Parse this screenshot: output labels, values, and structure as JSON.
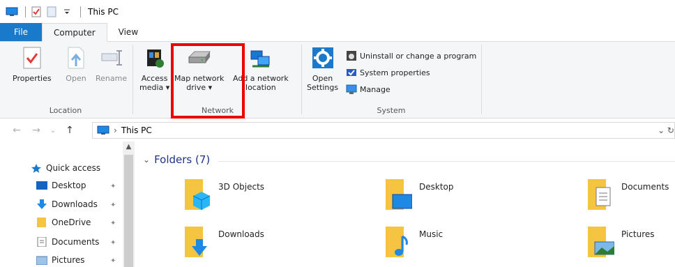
{
  "titlebar": {
    "title": "This PC"
  },
  "tabs": {
    "file": "File",
    "computer": "Computer",
    "view": "View"
  },
  "ribbon": {
    "location": {
      "label": "Location",
      "properties": "Properties",
      "open": "Open",
      "rename": "Rename"
    },
    "network": {
      "label": "Network",
      "access_media": [
        "Access",
        "media ▾"
      ],
      "map_drive": [
        "Map network",
        "drive ▾"
      ],
      "add_location": [
        "Add a network",
        "location"
      ]
    },
    "system": {
      "label": "System",
      "open_settings": [
        "Open",
        "Settings"
      ],
      "uninstall": "Uninstall or change a program",
      "system_properties": "System properties",
      "manage": "Manage"
    }
  },
  "address": {
    "path": "This PC"
  },
  "navpane": {
    "quick_access": "Quick access",
    "items": [
      "Desktop",
      "Downloads",
      "OneDrive",
      "Documents",
      "Pictures"
    ]
  },
  "content": {
    "section": "Folders (7)",
    "folders": [
      "3D Objects",
      "Desktop",
      "Documents",
      "Downloads",
      "Music",
      "Pictures"
    ]
  },
  "colors": {
    "accent": "#1979ca",
    "highlight": "#e00000",
    "folder": "#f5c542"
  }
}
